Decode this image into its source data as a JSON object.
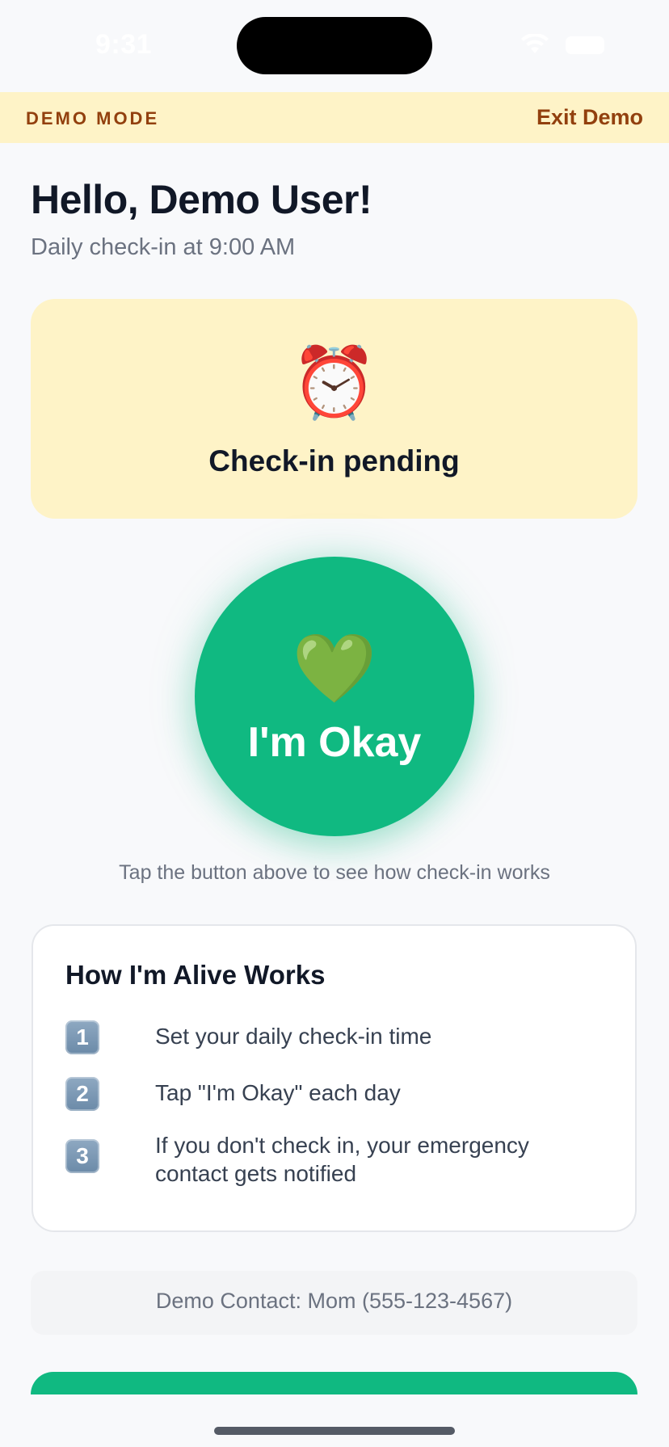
{
  "status_bar": {
    "time": "9:31",
    "wifi_icon": "wifi-icon",
    "battery_icon": "battery-icon"
  },
  "demo_banner": {
    "label": "DEMO MODE",
    "exit_label": "Exit Demo",
    "background": "#fef3c7",
    "text_color": "#92400e"
  },
  "header": {
    "greeting": "Hello, Demo User!",
    "subtitle": "Daily check-in at 9:00 AM"
  },
  "status_card": {
    "emoji": "⏰",
    "text": "Check-in pending",
    "background": "#fef3c7"
  },
  "okay_button": {
    "emoji": "💚",
    "label": "I'm Okay",
    "color": "#10b981"
  },
  "hint": "Tap the button above to see how check-in works",
  "how_it_works": {
    "title": "How I'm Alive Works",
    "steps": [
      {
        "badge": "1",
        "text": "Set your daily check-in time"
      },
      {
        "badge": "2",
        "text": "Tap \"I'm Okay\" each day"
      },
      {
        "badge": "3",
        "text": "If you don't check in, your emergency contact gets notified"
      }
    ]
  },
  "contact": {
    "text": "Demo Contact: Mom (555-123-4567)"
  }
}
